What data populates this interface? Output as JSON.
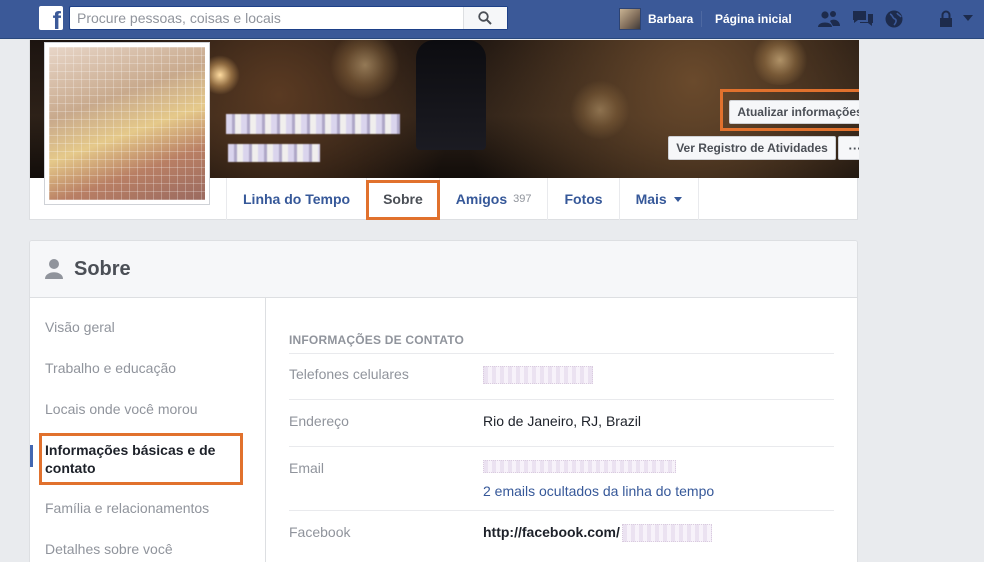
{
  "topbar": {
    "logo_letter": "f",
    "search_placeholder": "Procure pessoas, coisas e locais",
    "user_name": "Barbara",
    "home_label": "Página inicial",
    "icons": [
      "friends-icon",
      "messages-icon",
      "globe-icon",
      "privacy-lock-icon",
      "account-caret-icon"
    ]
  },
  "profile": {
    "update_button": "Atualizar informações",
    "activity_button": "Ver Registro de Atividades",
    "more_button": "···",
    "tabs": [
      {
        "label": "Linha do Tempo"
      },
      {
        "label": "Sobre"
      },
      {
        "label": "Amigos",
        "count": "397"
      },
      {
        "label": "Fotos"
      },
      {
        "label": "Mais"
      }
    ]
  },
  "about": {
    "title": "Sobre",
    "side_items": [
      "Visão geral",
      "Trabalho e educação",
      "Locais onde você morou",
      "Informações básicas e de contato",
      "Família e relacionamentos",
      "Detalhes sobre você"
    ],
    "active_side_item": "Informações básicas e de contato",
    "section_title": "INFORMAÇÕES DE CONTATO",
    "rows": {
      "phones_label": "Telefones celulares",
      "address_label": "Endereço",
      "address_value": "Rio de Janeiro, RJ, Brazil",
      "email_label": "Email",
      "email_hidden_link": "2 emails ocultados da linha do tempo",
      "facebook_label": "Facebook",
      "facebook_value": "http://facebook.com/"
    }
  },
  "colors": {
    "topbar": "#3b5998",
    "link": "#365899",
    "highlight": "#e1712d"
  }
}
